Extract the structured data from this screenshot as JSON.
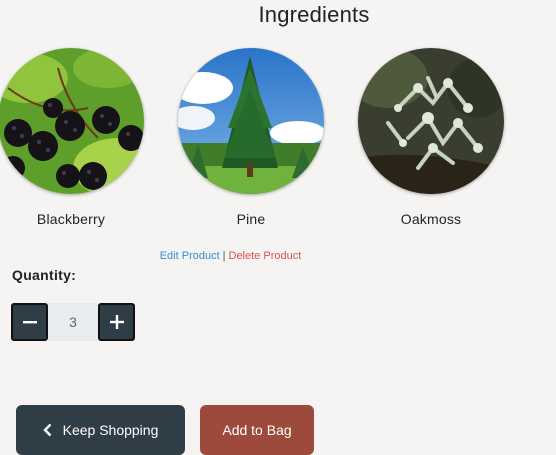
{
  "page": {
    "title": "Ingredients"
  },
  "ingredients": [
    {
      "name": "Blackberry",
      "image": "blackberry-photo"
    },
    {
      "name": "Pine",
      "image": "pine-tree-photo"
    },
    {
      "name": "Oakmoss",
      "image": "oakmoss-lichen-photo"
    }
  ],
  "product_links": {
    "edit_label": "Edit Product",
    "separator": "|",
    "delete_label": "Delete Product"
  },
  "quantity": {
    "label": "Quantity:",
    "value": "3",
    "decrement_icon": "minus-icon",
    "increment_icon": "plus-icon"
  },
  "actions": {
    "keep_shopping_label": "Keep Shopping",
    "keep_shopping_icon": "chevron-left-icon",
    "add_to_bag_label": "Add to Bag"
  },
  "colors": {
    "background": "#f6f4f3",
    "dark_button": "#2f3e46",
    "add_button": "#9b4a3c",
    "edit_link": "#2d8fd6",
    "delete_link": "#d9534f"
  }
}
